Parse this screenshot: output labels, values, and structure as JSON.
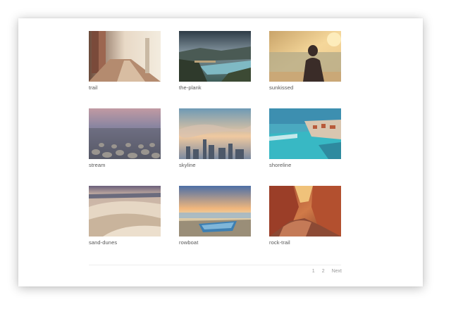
{
  "gallery": {
    "items": [
      {
        "caption": "trail",
        "scene": "trail-scene"
      },
      {
        "caption": "the-plank",
        "scene": "plank-scene"
      },
      {
        "caption": "sunkissed",
        "scene": "sunkissed-scene"
      },
      {
        "caption": "stream",
        "scene": "stream-scene"
      },
      {
        "caption": "skyline",
        "scene": "skyline-scene"
      },
      {
        "caption": "shoreline",
        "scene": "shoreline-scene"
      },
      {
        "caption": "sand-dunes",
        "scene": "dunes-scene"
      },
      {
        "caption": "rowboat",
        "scene": "rowboat-scene"
      },
      {
        "caption": "rock-trail",
        "scene": "rocks-scene"
      }
    ]
  },
  "pagination": {
    "pages": [
      "1",
      "2"
    ],
    "next_label": "Next"
  }
}
